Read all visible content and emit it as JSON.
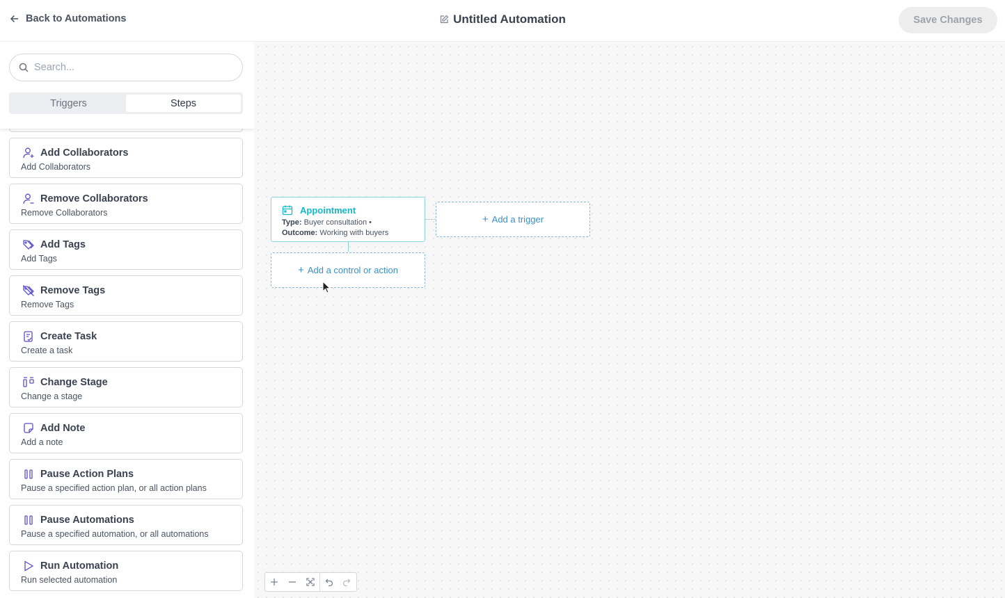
{
  "header": {
    "back_label": "Back to Automations",
    "title": "Untitled Automation",
    "save_label": "Save Changes"
  },
  "sidebar": {
    "search_placeholder": "Search...",
    "tabs": [
      {
        "label": "Triggers",
        "active": false
      },
      {
        "label": "Steps",
        "active": true
      }
    ],
    "steps": [
      {
        "icon": "user-plus-icon",
        "title": "Add Collaborators",
        "desc": "Add Collaborators"
      },
      {
        "icon": "user-minus-icon",
        "title": "Remove Collaborators",
        "desc": "Remove Collaborators"
      },
      {
        "icon": "tags-icon",
        "title": "Add Tags",
        "desc": "Add Tags"
      },
      {
        "icon": "tag-off-icon",
        "title": "Remove Tags",
        "desc": "Remove Tags"
      },
      {
        "icon": "task-icon",
        "title": "Create Task",
        "desc": "Create a task"
      },
      {
        "icon": "stage-icon",
        "title": "Change Stage",
        "desc": "Change a stage"
      },
      {
        "icon": "note-icon",
        "title": "Add Note",
        "desc": "Add a note"
      },
      {
        "icon": "pause-icon",
        "title": "Pause Action Plans",
        "desc": "Pause a specified action plan, or all action plans"
      },
      {
        "icon": "pause-icon",
        "title": "Pause Automations",
        "desc": "Pause a specified automation, or all automations"
      },
      {
        "icon": "play-icon",
        "title": "Run Automation",
        "desc": "Run selected automation"
      }
    ]
  },
  "canvas": {
    "trigger_node": {
      "title": "Appointment",
      "type_label": "Type:",
      "type_value": "Buyer consultation •",
      "outcome_label": "Outcome:",
      "outcome_value": "Working with buyers"
    },
    "add_trigger_label": "Add a trigger",
    "add_action_label": "Add a control or action"
  },
  "colors": {
    "accent_teal": "#14b8c7",
    "icon_purple": "#5b4fc7",
    "link_blue": "#3a8fc4"
  }
}
